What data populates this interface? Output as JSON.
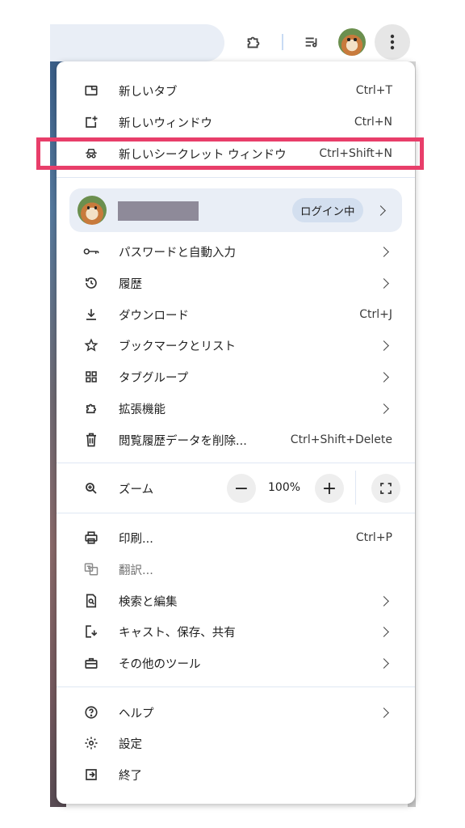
{
  "toolbar": {
    "extensions_icon": "puzzle-icon",
    "reading_list_icon": "reading-list-icon",
    "menu_icon": "kebab-menu-icon"
  },
  "menu": {
    "new_tab": {
      "label": "新しいタブ",
      "shortcut": "Ctrl+T"
    },
    "new_window": {
      "label": "新しいウィンドウ",
      "shortcut": "Ctrl+N"
    },
    "new_incognito": {
      "label": "新しいシークレット ウィンドウ",
      "shortcut": "Ctrl+Shift+N"
    },
    "profile": {
      "name": "",
      "status": "ログイン中"
    },
    "passwords": {
      "label": "パスワードと自動入力"
    },
    "history": {
      "label": "履歴"
    },
    "downloads": {
      "label": "ダウンロード",
      "shortcut": "Ctrl+J"
    },
    "bookmarks": {
      "label": "ブックマークとリスト"
    },
    "tab_groups": {
      "label": "タブグループ"
    },
    "extensions": {
      "label": "拡張機能"
    },
    "clear_data": {
      "label": "閲覧履歴データを削除...",
      "shortcut": "Ctrl+Shift+Delete"
    },
    "zoom": {
      "label": "ズーム",
      "minus": "−",
      "level": "100%",
      "plus": "+"
    },
    "print": {
      "label": "印刷...",
      "shortcut": "Ctrl+P"
    },
    "translate": {
      "label": "翻訳..."
    },
    "find_edit": {
      "label": "検索と編集"
    },
    "cast_save_share": {
      "label": "キャスト、保存、共有"
    },
    "more_tools": {
      "label": "その他のツール"
    },
    "help": {
      "label": "ヘルプ"
    },
    "settings": {
      "label": "設定"
    },
    "exit": {
      "label": "終了"
    }
  },
  "colors": {
    "highlight_border": "#e83e6a",
    "profile_bg": "#e9eef6",
    "signed_in_pill": "#d3dfef"
  }
}
